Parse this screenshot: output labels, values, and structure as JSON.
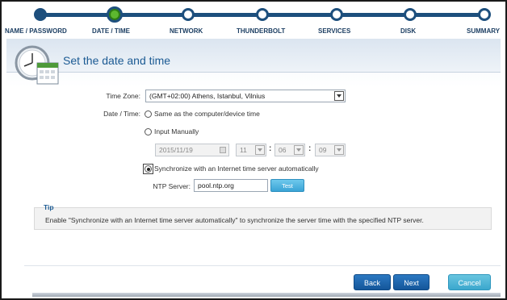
{
  "stepper": {
    "steps": [
      {
        "label": "NAME / PASSWORD",
        "state": "done"
      },
      {
        "label": "DATE / TIME",
        "state": "current"
      },
      {
        "label": "NETWORK",
        "state": "pending"
      },
      {
        "label": "THUNDERBOLT",
        "state": "pending"
      },
      {
        "label": "SERVICES",
        "state": "pending"
      },
      {
        "label": "DISK",
        "state": "pending"
      },
      {
        "label": "SUMMARY",
        "state": "pending"
      }
    ]
  },
  "page": {
    "title": "Set the date and time",
    "icon": "clock-calendar-icon"
  },
  "form": {
    "time_zone_label": "Time Zone:",
    "time_zone_value": "(GMT+02:00) Athens, Istanbul, Vilnius",
    "date_time_label": "Date / Time:",
    "option_same": "Same as the computer/device time",
    "option_manual": "Input Manually",
    "manual_date": "2015/11/19",
    "manual_hour": "11",
    "manual_minute": "06",
    "manual_second": "09",
    "option_sync": "Synchronize with an Internet time server automatically",
    "ntp_label": "NTP Server:",
    "ntp_value": "pool.ntp.org",
    "test_label": "Test"
  },
  "tip": {
    "title": "Tip",
    "text": "Enable \"Synchronize with an Internet time server automatically\" to synchronize the server time with the specified NTP server."
  },
  "buttons": {
    "back": "Back",
    "next": "Next",
    "cancel": "Cancel"
  },
  "colors": {
    "accent": "#1d4f7d",
    "current_step": "#5db82f",
    "title": "#1b5a93"
  }
}
